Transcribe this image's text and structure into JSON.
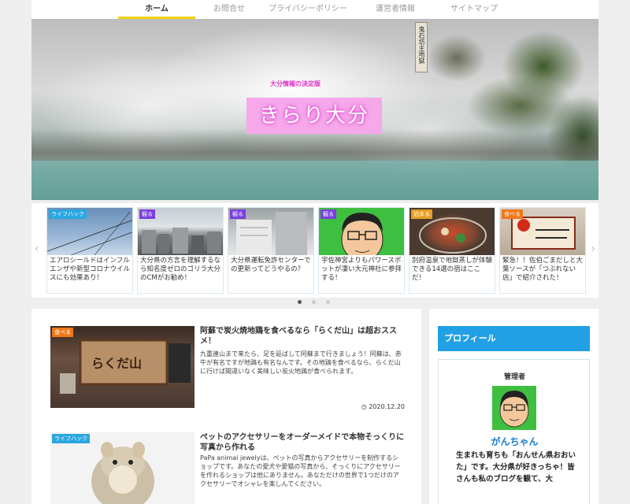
{
  "nav": {
    "items": [
      "ホーム",
      "お問合せ",
      "プライバシーポリシー",
      "運営者情報",
      "サイトマップ"
    ]
  },
  "hero": {
    "tagline": "大分情報の決定版",
    "logo": "きらり大分",
    "sign_text": "鬼石坊主地獄"
  },
  "carousel": {
    "cards": [
      {
        "category": "ライフハック",
        "category_color": "#2aa7e0",
        "title": "エアロシールドはインフルエンザや新型コロナウイルスにも効果あり！"
      },
      {
        "category": "観る",
        "category_color": "#7b3fe0",
        "title": "大分県の方言を理解するなら知名度ゼロのゴリラ大分のCMがお勧め！"
      },
      {
        "category": "観る",
        "category_color": "#7b3fe0",
        "title": "大分県運転免許センターでの更新ってどうやるの？"
      },
      {
        "category": "観る",
        "category_color": "#7b3fe0",
        "title": "宇佐神宮よりもパワースポットが凄い大元神社に参拝する！"
      },
      {
        "category": "泊まる",
        "category_color": "#e8a020",
        "title": "別府温泉で地獄蒸しが体験できる14選の宿はここだ！"
      },
      {
        "category": "食べる",
        "category_color": "#f07818",
        "title": "緊急！！佐伯ごまだしと大葉ソースが「つぶれない店」で紹介された！"
      }
    ]
  },
  "main": {
    "entries": [
      {
        "category": "食べる",
        "category_color": "#f07818",
        "title": "阿蘇で炭火焼地鶏を食べるなら「らくだ山」は超おススメ！",
        "snippet": "九重連山まで来たら、足を延ばして阿蘇まで行きましょう！阿蘇は、赤牛が有名ですが地鶏も有名なんです。その地鶏を食べるなら、らくだ山に行けば間違いなく美味しい炭火地鶏が食べられます。",
        "date": "2020.12.20",
        "sign_text": "らくだ山"
      },
      {
        "category": "ライフハック",
        "category_color": "#2aa7e0",
        "title": "ペットのアクセサリーをオーダーメイドで本物そっくりに写真から作れる",
        "snippet": "PaPa animal jewelyは、ペットの写真からアクセサリーを制作するショップです。あなたの愛犬や愛猫の写真から、そっくりにアクセサリーを作れるショップは他にありません。あなただけの世界で1つだけのアクセサリーでオシャレを楽しんでください。"
      }
    ]
  },
  "sidebar": {
    "profile_heading": "プロフィール",
    "admin_label": "管理者",
    "name": "がんちゃん",
    "bio": "生まれも育ちも「おんせん県おおいた」です。大分県が好きっちゃ！皆さんも私のブログを観て、大"
  }
}
